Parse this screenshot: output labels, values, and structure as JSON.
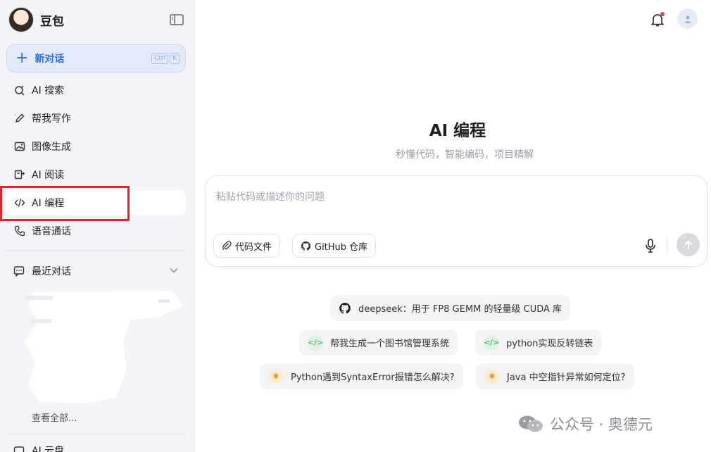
{
  "sidebar": {
    "brand_name": "豆包",
    "new_chat": {
      "label": "新对话",
      "shortcut_keys": [
        "Ctrl",
        "K"
      ]
    },
    "nav_items": [
      {
        "label": "AI 搜索",
        "icon": "search-sparkle-icon"
      },
      {
        "label": "帮我写作",
        "icon": "pen-icon"
      },
      {
        "label": "图像生成",
        "icon": "image-icon"
      },
      {
        "label": "AI 阅读",
        "icon": "book-icon"
      },
      {
        "label": "AI 编程",
        "icon": "code-icon",
        "active": true
      },
      {
        "label": "语音通话",
        "icon": "phone-icon"
      }
    ],
    "recent": {
      "label": "最近对话",
      "see_all": "查看全部..."
    },
    "bottom_item": "AI 云盘"
  },
  "main": {
    "title": "AI 编程",
    "subtitle": "秒懂代码，智能编码，项目精解",
    "input": {
      "placeholder": "粘贴代码或描述你的问题",
      "chips": [
        {
          "label": "代码文件",
          "icon": "paperclip-icon"
        },
        {
          "label": "GitHub 仓库",
          "icon": "github-icon"
        }
      ]
    },
    "suggestions": [
      {
        "label": "deepseek：用于 FP8 GEMM 的轻量级 CUDA 库",
        "icon": "github-icon"
      },
      {
        "label": "帮我生成一个图书馆管理系统",
        "icon": "code-icon"
      },
      {
        "label": "python实现反转链表",
        "icon": "code-icon"
      },
      {
        "label": "Python遇到SyntaxError报错怎么解决?",
        "icon": "bug-icon"
      },
      {
        "label": "Java 中空指针异常如何定位?",
        "icon": "bug-icon"
      }
    ]
  },
  "watermark": "公众号 · 奥德元",
  "colors": {
    "accent": "#2f6be5",
    "annotation": "#e0242f",
    "sidebar_bg": "#f3f4f7"
  }
}
